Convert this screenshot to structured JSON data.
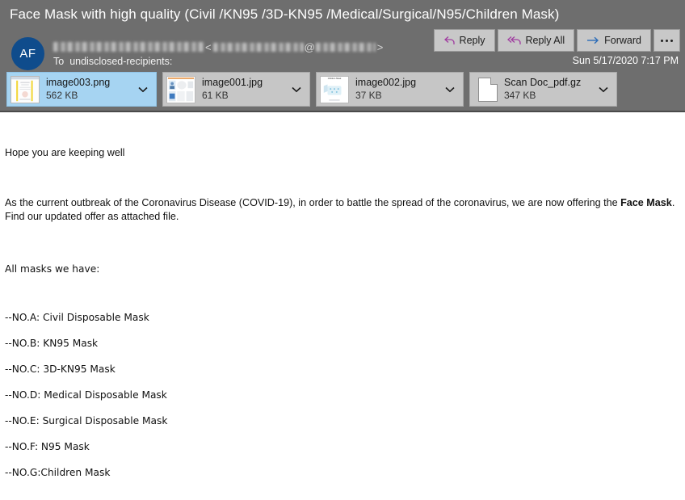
{
  "header": {
    "subject": "Face Mask with high quality (Civil /KN95 /3D-KN95 /Medical/Surgical/N95/Children Mask)",
    "avatar_initials": "AF",
    "sender_name_redacted": true,
    "sender_email_redacted": true,
    "email_at_symbol": "@",
    "bracket_open": "<",
    "bracket_close": ">",
    "to_label": "To",
    "to_value": "undisclosed-recipients:",
    "datetime": "Sun 5/17/2020 7:17 PM",
    "background_color": "#6e6e6e",
    "avatar_color": "#0f4c8c"
  },
  "actions": [
    {
      "label": "Reply",
      "icon": "reply-arrow-icon",
      "icon_color": "#a03ca0"
    },
    {
      "label": "Reply All",
      "icon": "reply-all-arrow-icon",
      "icon_color": "#a03ca0"
    },
    {
      "label": "Forward",
      "icon": "forward-arrow-icon",
      "icon_color": "#2b6cb8"
    }
  ],
  "more_actions_label": "...",
  "attachments": [
    {
      "name": "image003.png",
      "size": "562 KB",
      "kind": "image-thumbnail",
      "selected": true,
      "chevron": "chevron-down-icon"
    },
    {
      "name": "image001.jpg",
      "size": "61 KB",
      "kind": "image-thumbnail",
      "selected": false,
      "chevron": "chevron-down-icon"
    },
    {
      "name": "image002.jpg",
      "size": "37 KB",
      "kind": "image-thumbnail",
      "thumb_caption": "Children Mask",
      "selected": false,
      "chevron": "chevron-down-icon"
    },
    {
      "name": "Scan Doc_pdf.gz",
      "size": "347 KB",
      "kind": "file-document-icon",
      "selected": false,
      "chevron": "chevron-down-icon"
    }
  ],
  "body": {
    "greeting": "Hope you are keeping well",
    "offer_prefix": "As the current outbreak of the Coronavirus Disease (COVID-19), in order to battle the spread of the coronavirus, we are now offering the ",
    "offer_bold": "Face Mask",
    "offer_suffix": ". Find our updated offer as attached file.",
    "masks_heading": "All masks we have:",
    "mask_items": [
      "--NO.A: Civil Disposable Mask",
      "--NO.B: KN95 Mask",
      "--NO.C: 3D-KN95 Mask",
      "--NO.D: Medical Disposable Mask",
      "--NO.E: Surgical Disposable Mask",
      "--NO.F: N95 Mask",
      "--NO.G:Children Mask"
    ]
  }
}
